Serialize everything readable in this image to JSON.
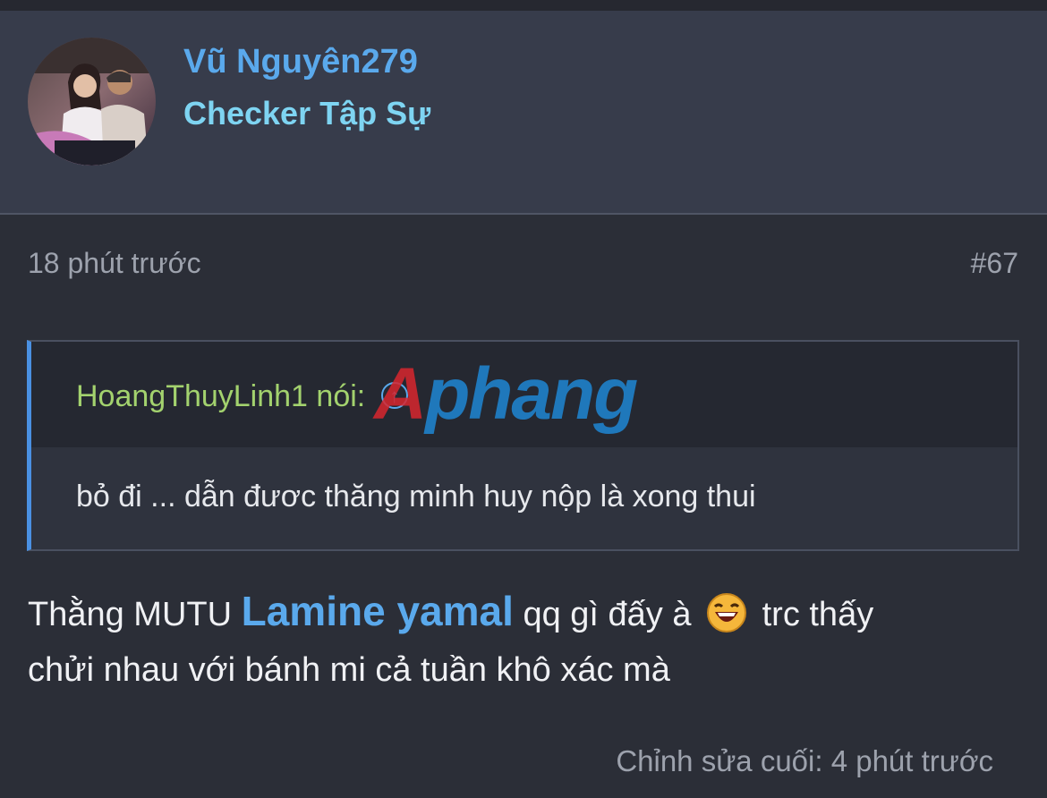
{
  "user": {
    "name": "Vũ Nguyên279",
    "title": "Checker Tập Sự"
  },
  "post": {
    "time": "18 phút trước",
    "number": "#67",
    "quote": {
      "author": "HoangThuyLinh1",
      "said_label": "nói:",
      "jump_icon": "arrow-up-circle-icon",
      "body": "bỏ đi ... dẫn đươc thăng minh huy nộp là xong thui"
    },
    "message": {
      "part1": "Thằng MUTU ",
      "mention": "Lamine yamal",
      "part2": " qq gì đấy à ",
      "emoji": "laughing-emoji",
      "part3": " trc thấy",
      "line2": "chửi nhau với bánh mi cả tuần khô xác mà"
    },
    "edited": "Chỉnh sửa cuối: 4 phút trước"
  },
  "watermark": {
    "first": "A",
    "rest": "phang"
  },
  "colors": {
    "background": "#2b2e37",
    "card": "#373c4b",
    "username": "#5aa9ec",
    "user_title": "#7ed4f2",
    "quote_author": "#a3d26e",
    "quote_bar": "#4a90e2"
  }
}
